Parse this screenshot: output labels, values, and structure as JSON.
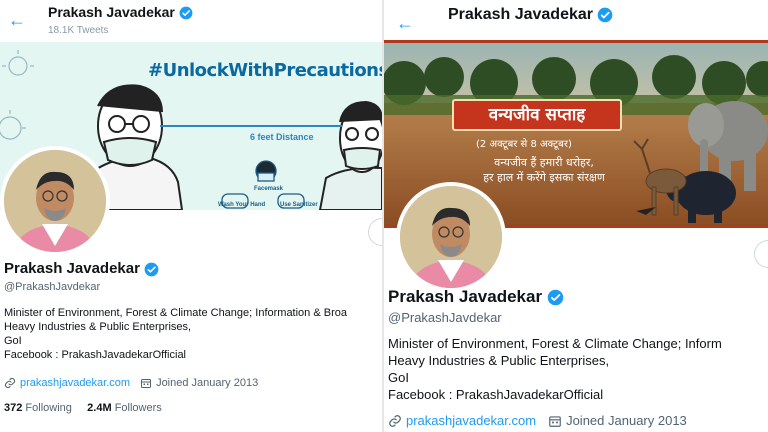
{
  "left": {
    "header": {
      "name": "Prakash Javadekar",
      "tweet_count": "18.1K Tweets"
    },
    "banner": {
      "hashtag": "#UnlockWithPrecautions",
      "distance": "6 feet Distance",
      "captions": [
        "Facemask",
        "Wash Your Hand",
        "Use Sanitizer"
      ]
    },
    "profile": {
      "name": "Prakash Javadekar",
      "handle": "@PrakashJavdekar",
      "bio": [
        "Minister of Environment, Forest & Climate Change; Information & Broa",
        "Heavy Industries & Public Enterprises,",
        "GoI",
        "Facebook : PrakashJavadekarOfficial"
      ],
      "website": "prakashjavadekar.com",
      "joined": "Joined January 2013",
      "following_count": "372",
      "following_label": "Following",
      "followers_count": "2.4M",
      "followers_label": "Followers"
    }
  },
  "right": {
    "header": {
      "name": "Prakash Javadekar"
    },
    "banner": {
      "title": "वन्यजीव सप्ताह",
      "dates": "(2 अक्टूबर से 8 अक्टूबर)",
      "tagline": [
        "वन्यजीव हैं हमारी धरोहर,",
        "हर हाल में करेंगे इसका संरक्षण"
      ]
    },
    "profile": {
      "name": "Prakash Javadekar",
      "handle": "@PrakashJavdekar",
      "bio": [
        "Minister of Environment, Forest & Climate Change; Inform",
        "Heavy Industries & Public Enterprises,",
        "GoI",
        "Facebook : PrakashJavadekarOfficial"
      ],
      "website": "prakashjavadekar.com",
      "joined": "Joined January 2013"
    }
  },
  "colors": {
    "accent": "#1d9bf0",
    "banner_red": "#c5341c",
    "banner_mint": "#e3f6f1"
  },
  "icons": [
    "back-arrow-icon",
    "verified-badge-icon",
    "link-icon",
    "calendar-icon"
  ]
}
